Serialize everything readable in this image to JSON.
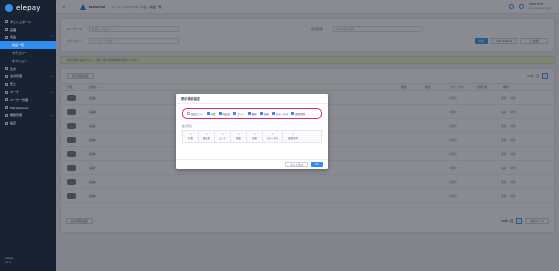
{
  "app": {
    "brand": "elepay"
  },
  "sidebar": {
    "items": [
      {
        "label": "ダッシュボード"
      },
      {
        "label": "店舗"
      },
      {
        "label": "商品"
      },
      {
        "label": "商品一覧",
        "active": true
      },
      {
        "label": "カテゴリー"
      },
      {
        "label": "オプション"
      },
      {
        "label": "注文"
      },
      {
        "label": "決済管理"
      },
      {
        "label": "売上"
      },
      {
        "label": "マーケ"
      },
      {
        "label": "ユーザー管理"
      },
      {
        "label": "Marketplace"
      },
      {
        "label": "機能管理"
      },
      {
        "label": "設定"
      }
    ],
    "bottom": [
      "elepay",
      "v1.0"
    ]
  },
  "topbar": {
    "shop": "ELESTYLE",
    "breadcrumb": [
      "ホーム",
      "ELESTYLE",
      "商品"
    ],
    "current": "商品一覧",
    "user_name": "ELESTYLE",
    "user_sub": "admin@elestyle.jp"
  },
  "filter": {
    "keyword_label": "キーワード",
    "keyword_placeholder": "商品名、商品コード",
    "category_label": "カテゴリー",
    "category_placeholder": "カテゴリーを選択",
    "status_label": "表示状態",
    "status_placeholder": "表示状態を選択",
    "search_button": "検索",
    "export_button": "CSV Export",
    "add_button": "＋ 新規"
  },
  "info_text": "表示項目を設定すると、商品一覧の表示内容を変更できます。",
  "table": {
    "settings_button": "表示項目設定",
    "per_page": "20件 / 頁",
    "page": "1",
    "headers": [
      "写真",
      "商品名",
      "価格",
      "在庫",
      "ステータス",
      "更新日時",
      "操作"
    ],
    "rows": [
      {
        "name": "商品A",
        "status": "公開中",
        "actions": "編集 ｜ 削除"
      },
      {
        "name": "商品B",
        "status": "公開中",
        "actions": "編集 ｜ 削除"
      },
      {
        "name": "商品C",
        "status": "公開中",
        "actions": "編集 ｜ 削除"
      },
      {
        "name": "商品D",
        "status": "公開中",
        "actions": "編集 ｜ 削除"
      },
      {
        "name": "商品E",
        "status": "公開中",
        "actions": "編集 ｜ 削除"
      },
      {
        "name": "商品F",
        "status": "公開中",
        "actions": "編集 ｜ 削除"
      },
      {
        "name": "商品G",
        "status": "公開中",
        "actions": "編集 ｜ 削除"
      },
      {
        "name": "商品H",
        "status": "公開中",
        "actions": "編集 ｜ 削除"
      }
    ],
    "next_label": "次のページ"
  },
  "modal": {
    "title": "表示項目設定",
    "checkboxes": [
      {
        "label": "商品コード",
        "checked": false
      },
      {
        "label": "写真",
        "checked": true
      },
      {
        "label": "商品名",
        "checked": true
      },
      {
        "label": "コード",
        "checked": true
      },
      {
        "label": "価格",
        "checked": true
      },
      {
        "label": "在庫",
        "checked": true
      },
      {
        "label": "ステータス",
        "checked": true
      },
      {
        "label": "更新日時",
        "checked": true
      }
    ],
    "order_label": "並び替え",
    "order_columns": [
      "写真",
      "商品名",
      "コード",
      "価格",
      "在庫",
      "ステータス",
      "更新日時"
    ],
    "cancel": "キャンセル",
    "ok": "OK"
  },
  "colors": {
    "accent": "#2f8cf0",
    "sidebar": "#182233",
    "highlight": "#e0267d"
  }
}
